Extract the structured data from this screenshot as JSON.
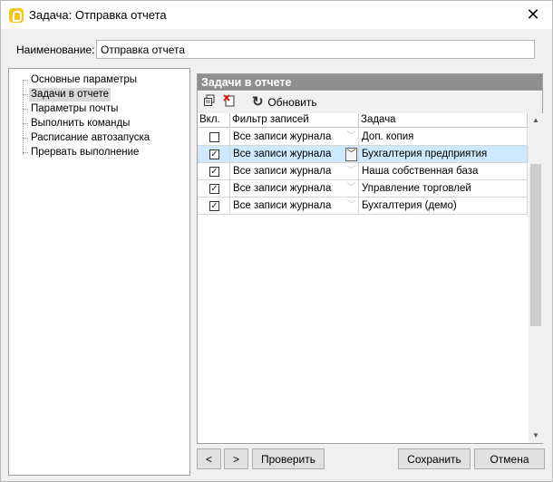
{
  "window": {
    "title": "Задача: Отправка отчета",
    "close_glyph": "✕"
  },
  "name": {
    "label": "Наименование:",
    "value": "Отправка отчета"
  },
  "tree": {
    "items": [
      {
        "label": "Основные параметры"
      },
      {
        "label": "Задачи в отчете",
        "selected": true
      },
      {
        "label": "Параметры почты"
      },
      {
        "label": "Выполнить команды"
      },
      {
        "label": "Расписание автозапуска"
      },
      {
        "label": "Прервать выполнение"
      }
    ]
  },
  "panel": {
    "header": "Задачи в отчете",
    "toolbar": {
      "copy_icon": "copy-icon",
      "delete_icon": "delete-icon",
      "refresh_label": "Обновить",
      "refresh_icon": "refresh-icon"
    },
    "columns": {
      "enabled": "Вкл.",
      "filter": "Фильтр записей",
      "task": "Задача"
    },
    "rows": [
      {
        "checked": false,
        "checkmark": "",
        "filter": "Все записи журнала",
        "task": "Доп. копия"
      },
      {
        "checked": true,
        "checkmark": "✓",
        "filter": "Все записи журнала",
        "task": "Бухгалтерия предприятия",
        "selected": true
      },
      {
        "checked": true,
        "checkmark": "✓",
        "filter": "Все записи журнала",
        "task": "Наша собственная база"
      },
      {
        "checked": true,
        "checkmark": "✓",
        "filter": "Все записи журнала",
        "task": "Управление торговлей"
      },
      {
        "checked": true,
        "checkmark": "✓",
        "filter": "Все записи журнала",
        "task": "Бухгалтерия (демо)"
      }
    ]
  },
  "buttons": {
    "prev": "<",
    "next": ">",
    "check": "Проверить",
    "save": "Сохранить",
    "cancel": "Отмена"
  },
  "colors": {
    "selected_row": "#cde8ff",
    "panel_header": "#8f8f8f"
  }
}
